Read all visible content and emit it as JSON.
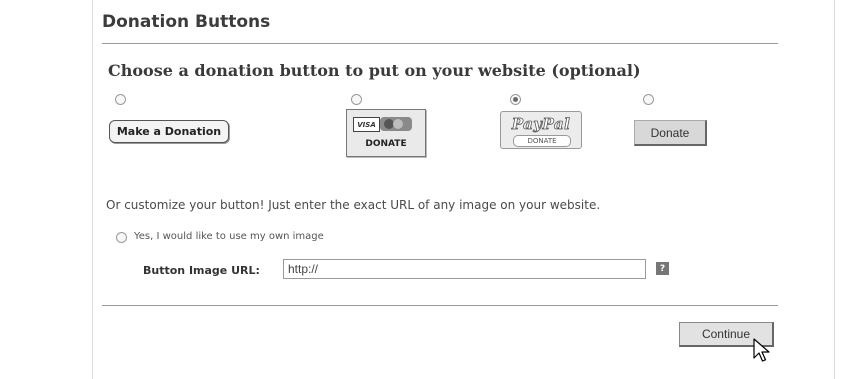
{
  "section": {
    "title": "Donation Buttons"
  },
  "choose": {
    "heading": "Choose a donation button to put on your website (optional)",
    "options": [
      {
        "label": "Make a Donation",
        "selected": false
      },
      {
        "card_text": "VISA",
        "label": "DONATE",
        "selected": false
      },
      {
        "logo": "PayPal",
        "label": "DONATE",
        "selected": true
      },
      {
        "label": "Donate",
        "selected": false
      }
    ]
  },
  "custom": {
    "text": "Or customize your button! Just enter the exact URL of any image on your website.",
    "own_image_label": "Yes, I would like to use my own image",
    "url_label": "Button Image URL:",
    "url_value": "http://",
    "help_icon": "?"
  },
  "footer": {
    "continue_label": "Continue"
  },
  "icons": {
    "cursor": "arrow-pointer-icon",
    "help": "help-icon"
  }
}
